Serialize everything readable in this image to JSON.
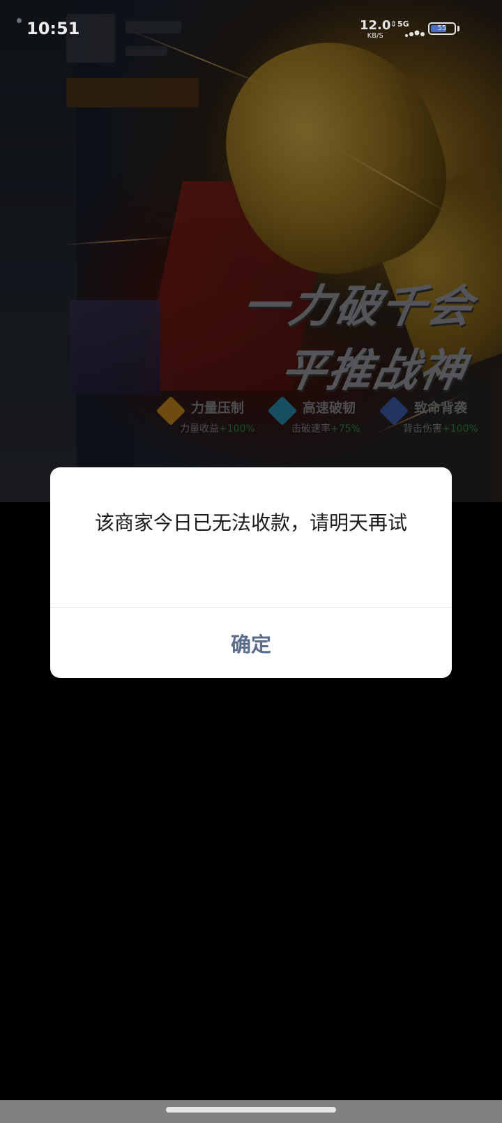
{
  "status_bar": {
    "time": "10:51",
    "net_speed": "12.0",
    "net_unit": "KB/S",
    "network_type": "5G",
    "battery_level": "55"
  },
  "banner": {
    "slogan_line1": "一力破千会",
    "slogan_line2": "平推战神",
    "skills": [
      {
        "title": "力量压制",
        "desc": "力量收益",
        "gain": "+100%",
        "icon": "strength-icon",
        "color": "#c98a1e"
      },
      {
        "title": "高速破韧",
        "desc": "击破速率",
        "gain": "+75%",
        "icon": "speed-icon",
        "color": "#2a8fb0"
      },
      {
        "title": "致命背袭",
        "desc": "背击伤害",
        "gain": "+100%",
        "icon": "backstab-icon",
        "color": "#3e5fb0"
      }
    ]
  },
  "dialog": {
    "message": "该商家今日已无法收款，请明天再试",
    "confirm_label": "确定"
  },
  "colors": {
    "dialog_button": "#5a6b8c",
    "skill_gain": "#2e8f4a"
  }
}
